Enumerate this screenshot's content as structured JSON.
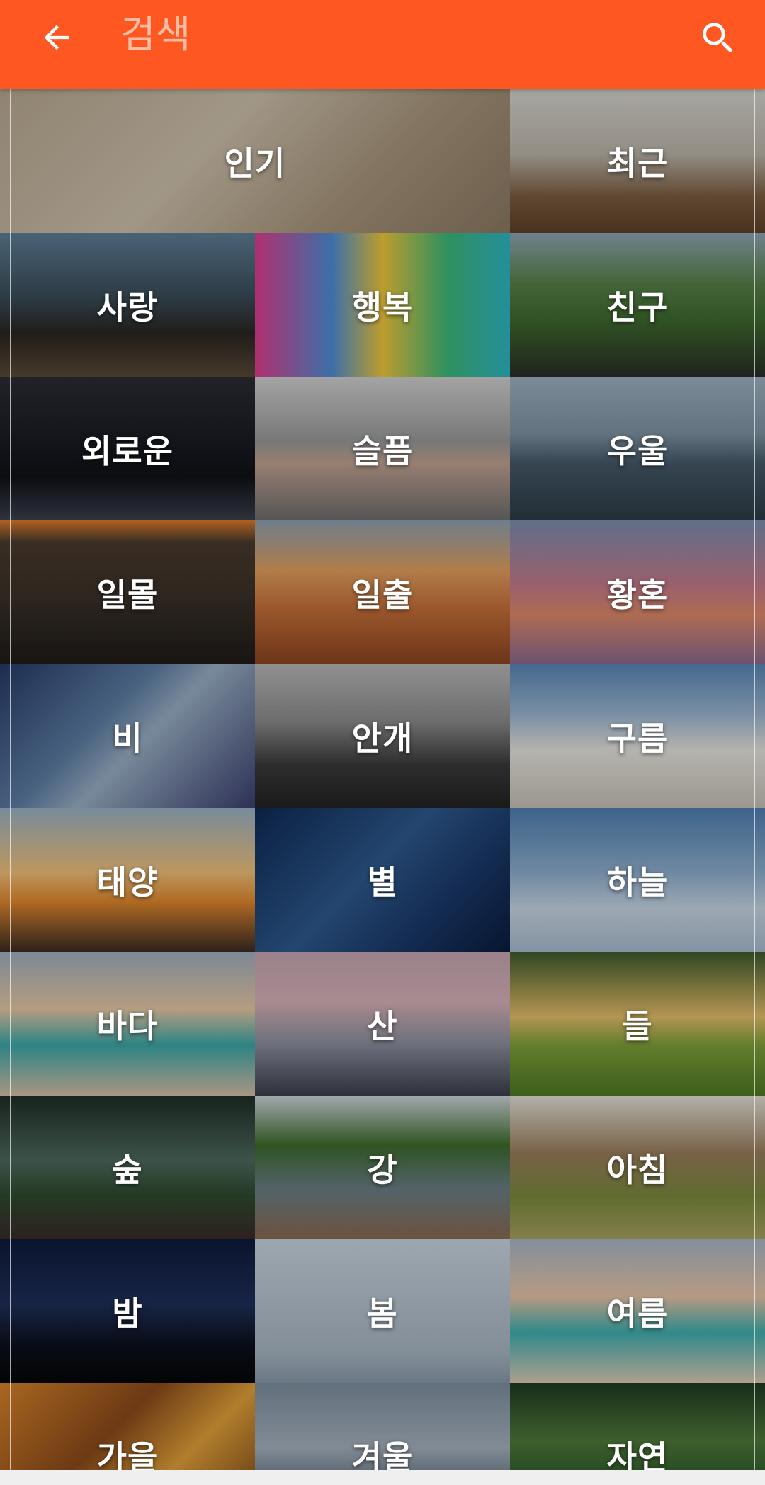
{
  "appbar": {
    "title": "검색",
    "accent_color": "#FF5722",
    "back_icon": "arrow-left-icon",
    "search_icon": "search-icon"
  },
  "categories": [
    {
      "label": "인기",
      "bg": "linear-gradient(135deg,#b9a992 0%,#cfc2ad 40%,#a8967c 70%,#8c7a62 100%)",
      "colspan": 2
    },
    {
      "label": "최근",
      "bg": "linear-gradient(180deg,#d8d6cf 0%,#bdb6aa 45%,#7b5c3f 75%,#5e3f27 100%)"
    },
    {
      "label": "사랑",
      "bg": "linear-gradient(180deg,#5e7f96 0%,#3a4c58 45%,#2a2621 70%,#5b4a37 100%)"
    },
    {
      "label": "행복",
      "bg": "linear-gradient(90deg,#e23f8f 0%,#4e8fd8 30%,#f2c93c 50%,#3dba7a 75%,#2fb8c6 100%)"
    },
    {
      "label": "친구",
      "bg": "linear-gradient(180deg,#8fa7b6 0%,#58824a 35%,#3e6b2f 60%,#2a2d26 100%)"
    },
    {
      "label": "외로운",
      "bg": "linear-gradient(180deg,#2a2d35 0%,#1a1d25 40%,#0f1116 70%,#3b4150 100%)"
    },
    {
      "label": "슬픔",
      "bg": "linear-gradient(180deg,#d2d2d2 0%,#9a9a9a 45%,#c2a392 60%,#6e6e6e 100%)"
    },
    {
      "label": "우울",
      "bg": "linear-gradient(180deg,#9fb3c2 0%,#7e93a3 40%,#465a69 60%,#2c3b47 100%)"
    },
    {
      "label": "일몰",
      "bg": "linear-gradient(180deg,#e27b2a 0%,#4a3b2e 15%,#3a3028 55%,#1e1b18 100%)"
    },
    {
      "label": "일출",
      "bg": "linear-gradient(180deg,#8fa2b4 0%,#e3a060 35%,#c9713a 60%,#8b4420 100%)"
    },
    {
      "label": "황혼",
      "bg": "linear-gradient(180deg,#7e8eb0 0%,#c67b8c 45%,#e08a6a 65%,#8c6a90 100%)"
    },
    {
      "label": "비",
      "bg": "linear-gradient(135deg,#253a66 0%,#5f7fa6 40%,#9ab0c6 55%,#3a3f6e 100%)"
    },
    {
      "label": "안개",
      "bg": "linear-gradient(180deg,#b9b9b9 0%,#8c8c8c 40%,#3a3a3a 70%,#222222 100%)"
    },
    {
      "label": "구름",
      "bg": "linear-gradient(180deg,#5a86b6 0%,#9db8d2 35%,#e8e6e0 60%,#c8c2b6 100%)"
    },
    {
      "label": "태양",
      "bg": "linear-gradient(180deg,#9ab4c6 0%,#f2c27a 45%,#e2892e 65%,#3a2a22 100%)"
    },
    {
      "label": "별",
      "bg": "linear-gradient(135deg,#0e2a55 0%,#2e5a8e 45%,#1b3a6b 70%,#0a1c3d 100%)"
    },
    {
      "label": "하늘",
      "bg": "linear-gradient(180deg,#4f7fb2 0%,#8fb0d0 45%,#c9d8e6 70%,#a9bcd0 100%)"
    },
    {
      "label": "바다",
      "bg": "linear-gradient(180deg,#9fb0c0 0%,#e8c9a6 40%,#3aa9a8 65%,#d8c1a8 100%)"
    },
    {
      "label": "산",
      "bg": "linear-gradient(180deg,#c6a6b2 0%,#d8b2b8 35%,#8a8f9e 65%,#3b3e4c 100%)"
    },
    {
      "label": "들",
      "bg": "linear-gradient(180deg,#3e5a2c 0%,#e6c06a 45%,#7fa13a 65%,#4f7a22 100%)"
    },
    {
      "label": "숲",
      "bg": "linear-gradient(180deg,#1f2d26 0%,#4e6b5e 45%,#2f4a2e 70%,#3a2a2a 100%)"
    },
    {
      "label": "강",
      "bg": "linear-gradient(180deg,#cfd8de 0%,#3d6b2c 35%,#6b7f86 65%,#8b6b52 100%)"
    },
    {
      "label": "아침",
      "bg": "linear-gradient(180deg,#e6e3d9 0%,#9a7e5c 40%,#7d8a3e 70%,#a9a460 100%)"
    },
    {
      "label": "밤",
      "bg": "linear-gradient(180deg,#0e1a3a 0%,#1f2f5a 45%,#0b0f1a 75%,#050608 100%)"
    },
    {
      "label": "봄",
      "bg": "linear-gradient(180deg,#cbd6e0 0%,#b4c2cf 50%,#a8b6c2 80%,#8899a8 100%)"
    },
    {
      "label": "여름",
      "bg": "linear-gradient(180deg,#a9b8c8 0%,#e8c6a8 40%,#3eb0b0 65%,#e0cdb8 100%)"
    },
    {
      "label": "가을",
      "bg": "linear-gradient(135deg,#d9842a 0%,#8b4a1a 40%,#e3a23a 65%,#6a3a12 100%)"
    },
    {
      "label": "겨울",
      "bg": "linear-gradient(180deg,#7e8fa0 0%,#a6b3bf 45%,#5a6a7a 75%,#c8d0d8 100%)"
    },
    {
      "label": "자연",
      "bg": "linear-gradient(180deg,#1e3a22 0%,#4e7a3a 40%,#2c5a2a 70%,#6a9a4a 100%)"
    }
  ]
}
